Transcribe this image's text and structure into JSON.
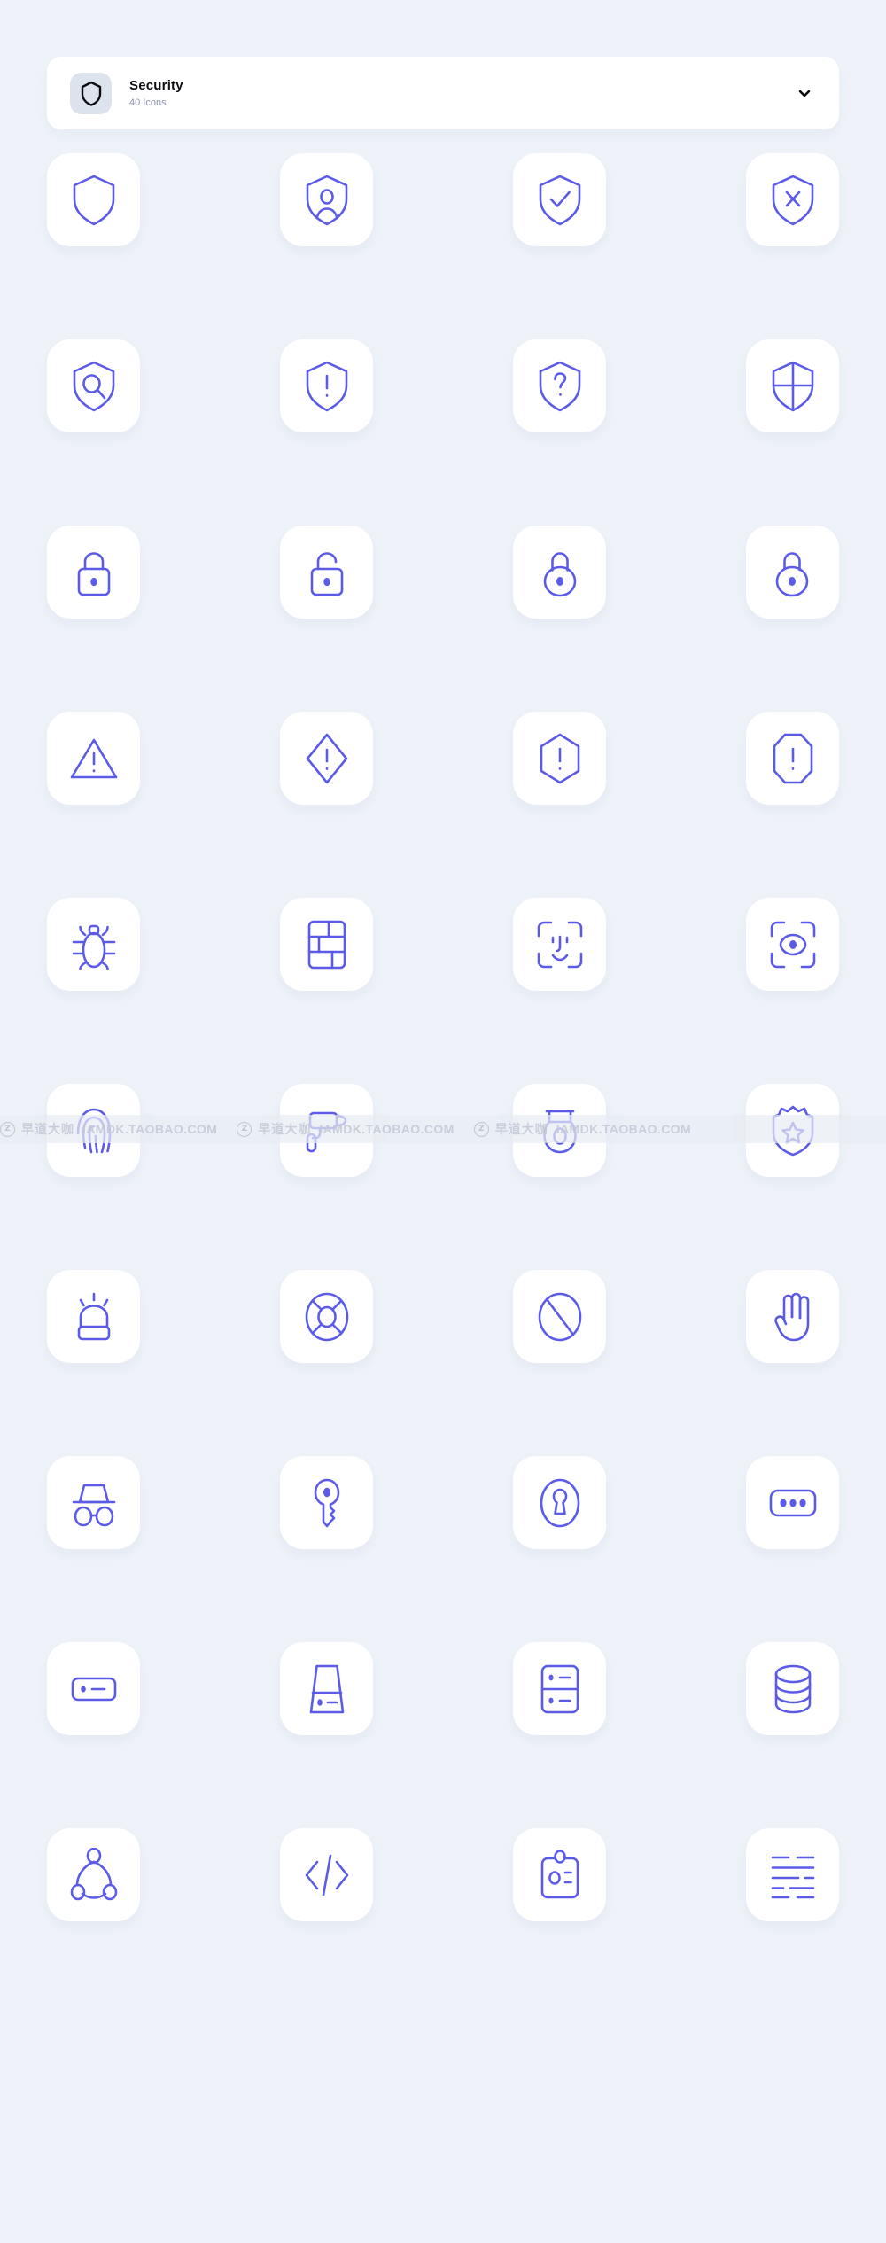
{
  "header": {
    "icon": "shield-icon",
    "title": "Security",
    "subtitle": "40 Icons",
    "chevron": "chevron-down-icon"
  },
  "colors": {
    "background": "#eff3f9",
    "card": "#ffffff",
    "icon_stroke": "#5b5be8",
    "title": "#0b0d12",
    "subtitle": "#8b93b0",
    "thumb_bg": "#dde3ed"
  },
  "grid": {
    "columns": 4,
    "rows": 10,
    "count": 40,
    "icons": [
      {
        "name": "shield-icon",
        "label": "Shield"
      },
      {
        "name": "shield-user-icon",
        "label": "Shield User"
      },
      {
        "name": "shield-check-icon",
        "label": "Shield Check"
      },
      {
        "name": "shield-x-icon",
        "label": "Shield Close"
      },
      {
        "name": "shield-search-icon",
        "label": "Shield Search"
      },
      {
        "name": "shield-alert-icon",
        "label": "Shield Alert"
      },
      {
        "name": "shield-question-icon",
        "label": "Shield Question"
      },
      {
        "name": "shield-cross-icon",
        "label": "Shield Cross"
      },
      {
        "name": "lock-closed-icon",
        "label": "Lock"
      },
      {
        "name": "lock-open-icon",
        "label": "Unlock"
      },
      {
        "name": "padlock-round-icon",
        "label": "Padlock"
      },
      {
        "name": "padlock-round-open-icon",
        "label": "Padlock Open"
      },
      {
        "name": "triangle-alert-icon",
        "label": "Warning Triangle"
      },
      {
        "name": "diamond-alert-icon",
        "label": "Warning Diamond"
      },
      {
        "name": "hexagon-alert-icon",
        "label": "Warning Hexagon"
      },
      {
        "name": "octagon-alert-icon",
        "label": "Warning Octagon"
      },
      {
        "name": "bug-icon",
        "label": "Bug"
      },
      {
        "name": "firewall-icon",
        "label": "Firewall"
      },
      {
        "name": "face-id-icon",
        "label": "Face ID"
      },
      {
        "name": "eye-scan-icon",
        "label": "Eye Scan"
      },
      {
        "name": "fingerprint-icon",
        "label": "Fingerprint"
      },
      {
        "name": "cctv-camera-icon",
        "label": "CCTV Camera"
      },
      {
        "name": "dome-camera-icon",
        "label": "Dome Camera"
      },
      {
        "name": "police-badge-icon",
        "label": "Police Badge"
      },
      {
        "name": "siren-icon",
        "label": "Siren"
      },
      {
        "name": "lifebuoy-icon",
        "label": "Lifebuoy"
      },
      {
        "name": "ban-icon",
        "label": "Ban"
      },
      {
        "name": "stop-hand-icon",
        "label": "Stop Hand"
      },
      {
        "name": "incognito-icon",
        "label": "Incognito"
      },
      {
        "name": "key-icon",
        "label": "Key"
      },
      {
        "name": "keyhole-icon",
        "label": "Keyhole"
      },
      {
        "name": "password-dots-icon",
        "label": "Password"
      },
      {
        "name": "server-icon",
        "label": "Server"
      },
      {
        "name": "tower-server-icon",
        "label": "Tower Server"
      },
      {
        "name": "server-rack-icon",
        "label": "Server Rack"
      },
      {
        "name": "database-icon",
        "label": "Database"
      },
      {
        "name": "network-nodes-icon",
        "label": "Network"
      },
      {
        "name": "code-icon",
        "label": "Code"
      },
      {
        "name": "id-card-icon",
        "label": "ID Card"
      },
      {
        "name": "log-lines-icon",
        "label": "Logs"
      }
    ]
  },
  "watermark": {
    "badge": "Z",
    "chinese": "早道大咖",
    "url": "IAMDK.TAOBAO.COM",
    "repeat": 3
  }
}
